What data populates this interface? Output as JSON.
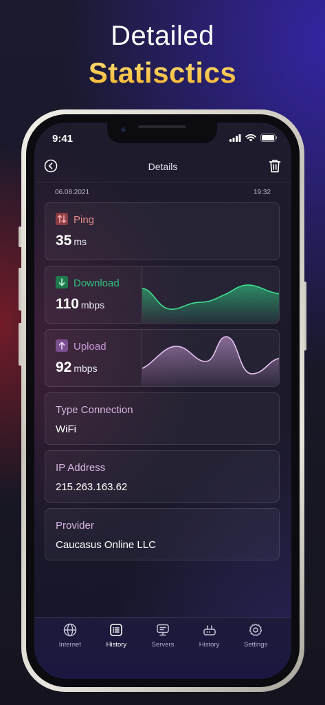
{
  "headline": {
    "line1": "Detailed",
    "line2": "Statisctics"
  },
  "status": {
    "time": "9:41"
  },
  "topbar": {
    "title": "Details"
  },
  "meta": {
    "date": "06.08.2021",
    "time": "19:32"
  },
  "ping": {
    "label": "Ping",
    "value": "35",
    "unit": "ms",
    "color": "#e38a8a"
  },
  "download": {
    "label": "Download",
    "value": "110",
    "unit": "mbps",
    "color": "#2ec27e"
  },
  "upload": {
    "label": "Upload",
    "value": "92",
    "unit": "mbps",
    "color": "#c99bd8"
  },
  "info": [
    {
      "label": "Type Connection",
      "value": "WiFi"
    },
    {
      "label": "IP Address",
      "value": "215.263.163.62"
    },
    {
      "label": "Provider",
      "value": "Caucasus Online LLC"
    }
  ],
  "tabs": [
    {
      "label": "Internet",
      "icon": "globe-icon",
      "active": false
    },
    {
      "label": "History",
      "icon": "list-icon",
      "active": true
    },
    {
      "label": "Servers",
      "icon": "server-icon",
      "active": false
    },
    {
      "label": "History",
      "icon": "router-icon",
      "active": false
    },
    {
      "label": "Settings",
      "icon": "gear-icon",
      "active": false
    }
  ],
  "colors": {
    "accent_gold": "#f3b12a",
    "download_green": "#2ec27e",
    "upload_purple": "#c99bd8",
    "ping_red": "#e38a8a"
  }
}
